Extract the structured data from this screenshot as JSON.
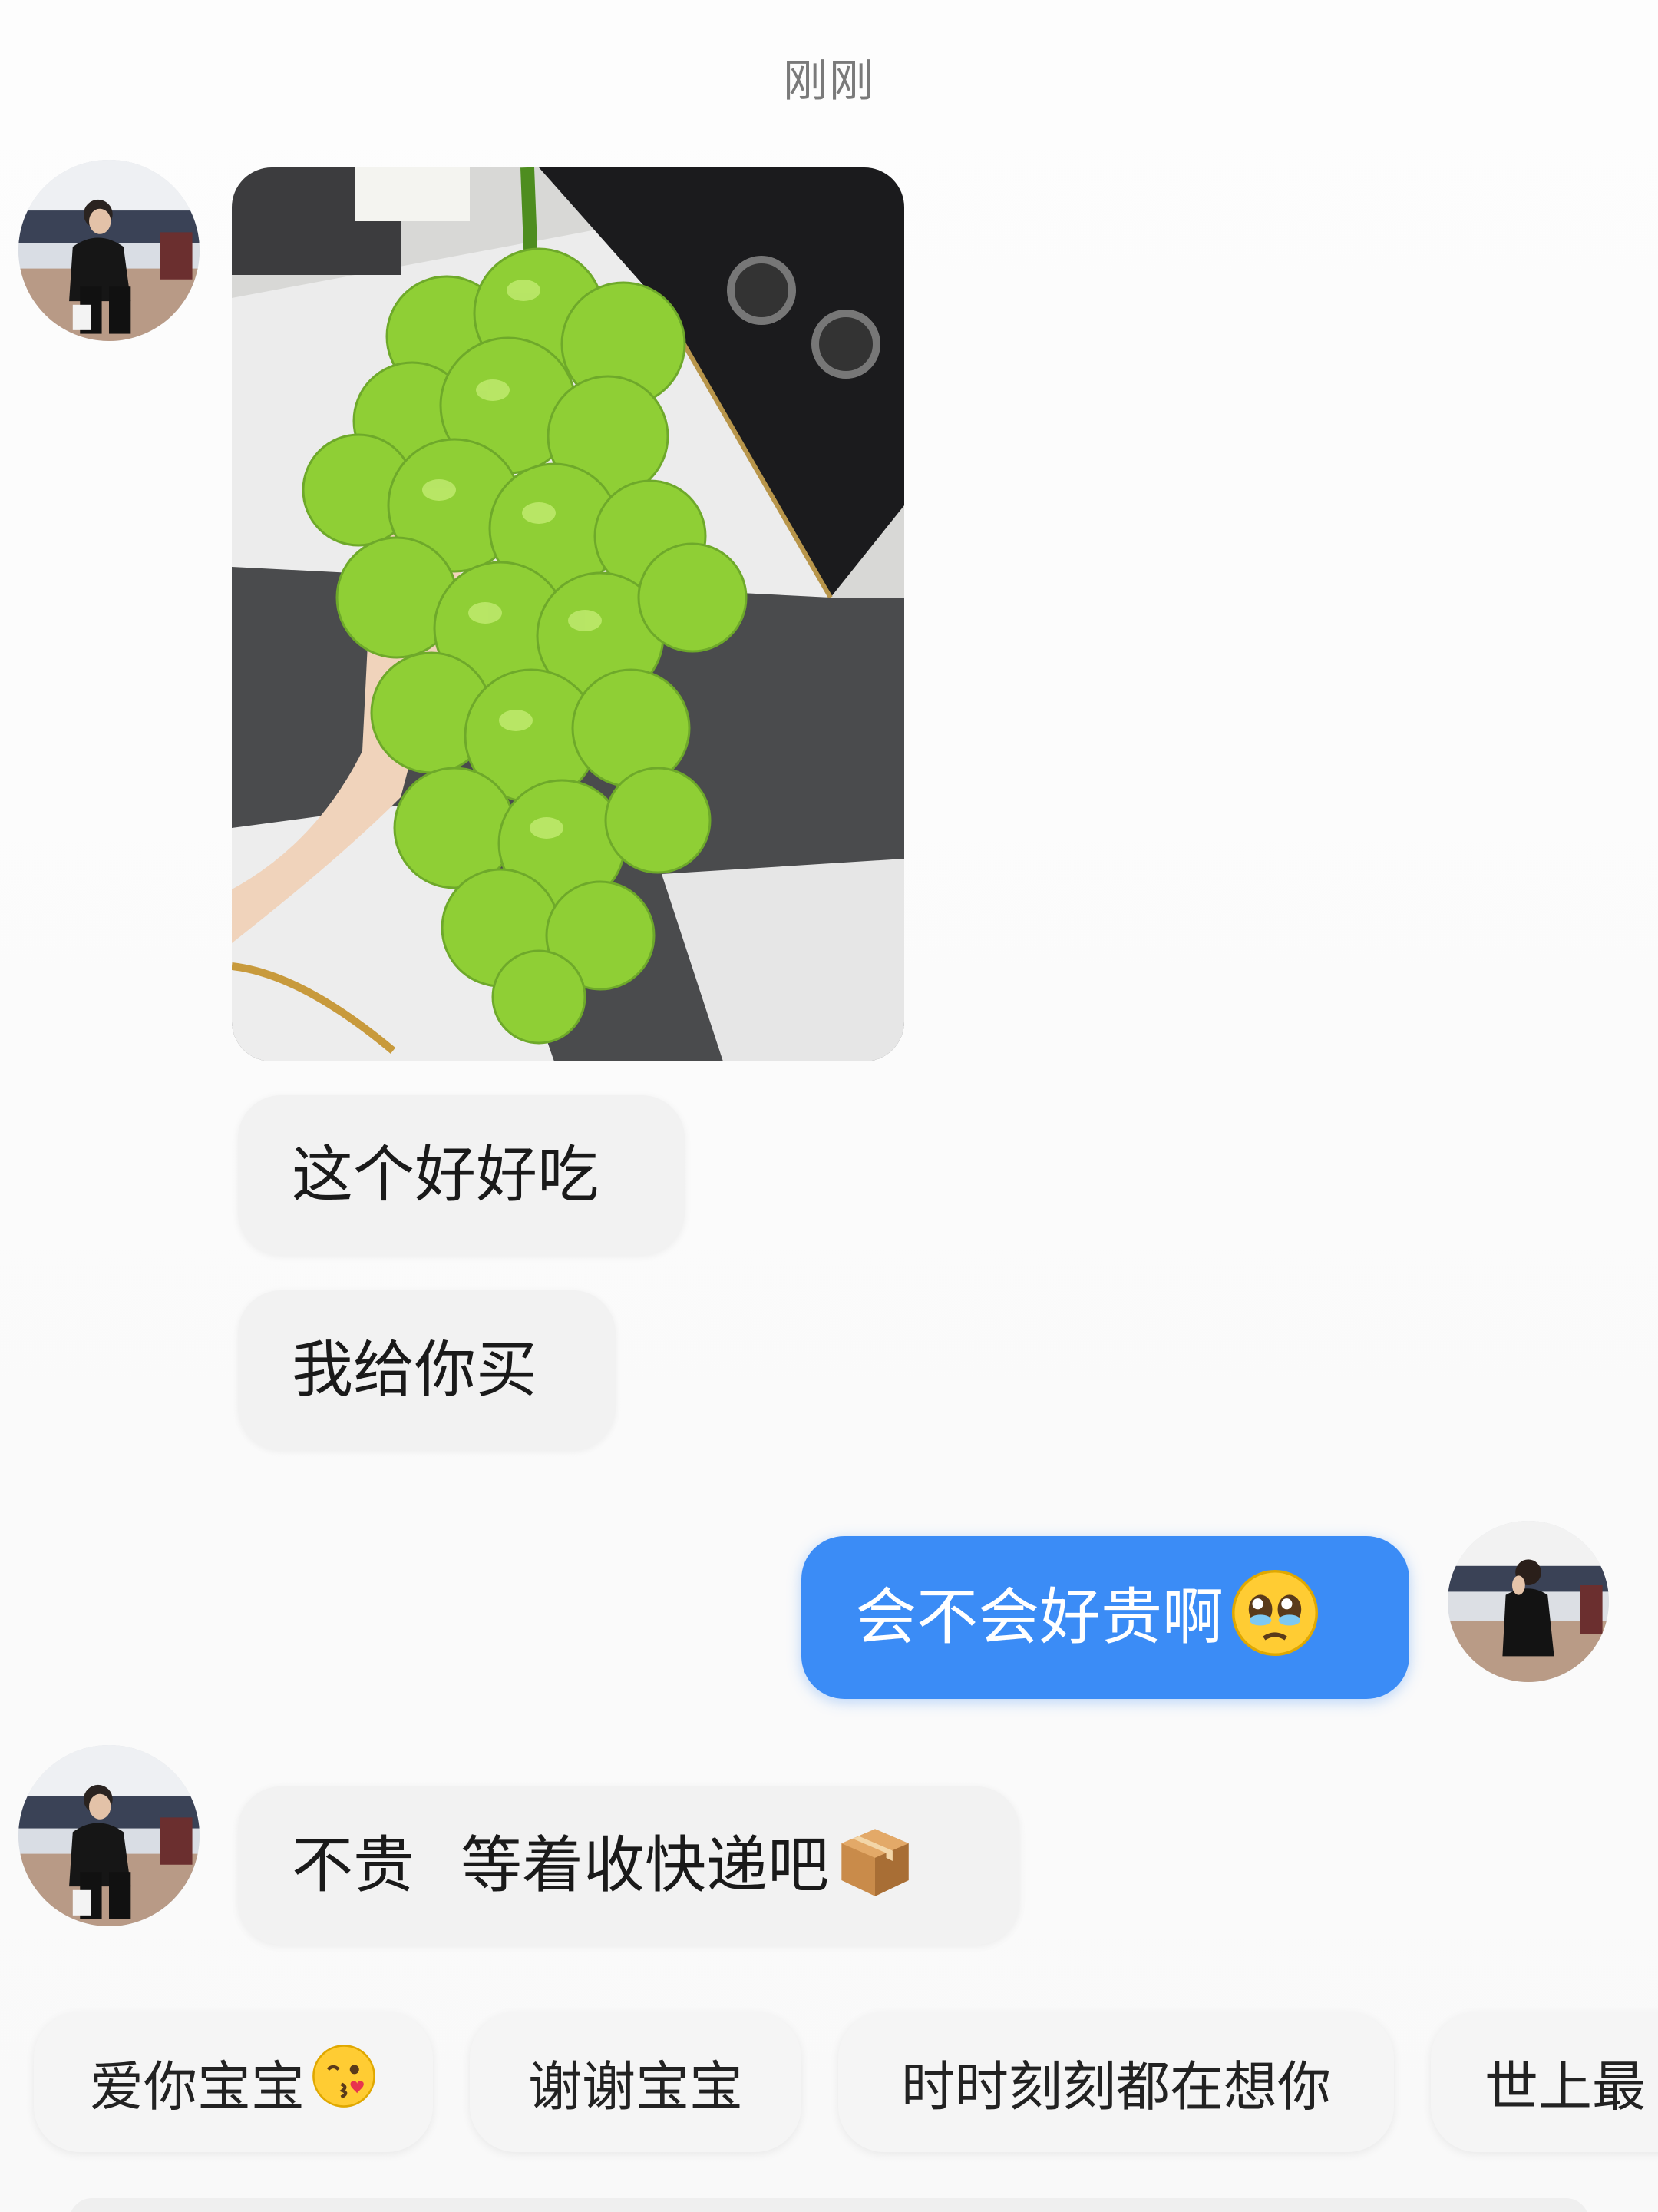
{
  "header": {
    "timestamp": "刚刚"
  },
  "messages": [
    {
      "sender": "other",
      "type": "image",
      "alt": "green grapes photo"
    },
    {
      "sender": "other",
      "type": "text",
      "text": "这个好好吃"
    },
    {
      "sender": "other",
      "type": "text",
      "text": "我给你买"
    },
    {
      "sender": "me",
      "type": "text",
      "text": "会不会好贵啊",
      "emoji": "pleading-face-icon"
    },
    {
      "sender": "other",
      "type": "text",
      "text_part1": "不贵",
      "text_part2": "等着收快递吧",
      "emoji": "package-icon"
    }
  ],
  "quick_replies": [
    {
      "label": "爱你宝宝",
      "emoji": "kissing-face-icon"
    },
    {
      "label": "谢谢宝宝"
    },
    {
      "label": "时时刻刻都在想你"
    },
    {
      "label": "世上最"
    }
  ],
  "colors": {
    "outgoing_bubble": "#3b8cf6",
    "incoming_bubble": "#f2f2f2",
    "timestamp_text": "#7a7a7a"
  }
}
